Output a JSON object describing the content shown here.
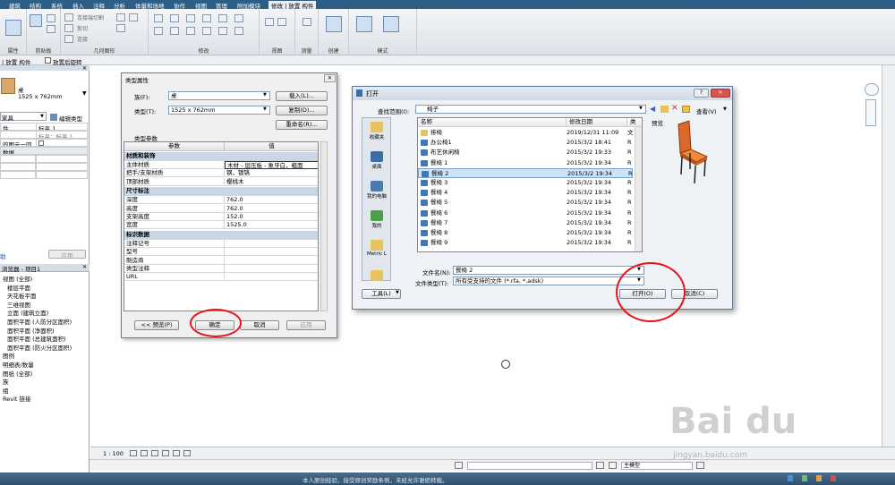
{
  "ribbon": {
    "tabs": [
      "建筑",
      "结构",
      "系统",
      "插入",
      "注释",
      "分析",
      "体量和场地",
      "协作",
      "视图",
      "管理",
      "附加模块",
      "修改 | 放置 构件"
    ],
    "groups": [
      "属性",
      "剪贴板",
      "几何图形",
      "修改",
      "视图",
      "测量",
      "创建",
      "模式"
    ],
    "small_items": [
      "连接端切割",
      "剪切",
      "连接"
    ]
  },
  "option_bar": {
    "left": "| 放置 构件",
    "rotate_label": "放置后旋转"
  },
  "properties_panel": {
    "title": "桌",
    "size": "1525 x 762mm",
    "type_selector": "家具",
    "edit_type": "编辑类型",
    "rows": [
      {
        "label": "件",
        "value": "标高 1"
      },
      {
        "label": "",
        "value": "标高：标高 1"
      },
      {
        "label": "的图元一同...",
        "value": ""
      },
      {
        "label": "数据",
        "value": ""
      }
    ],
    "help": "助",
    "apply": "应用"
  },
  "project_browser": {
    "title": "浏览器 - 项目1",
    "items": [
      "视图 (全部)",
      "楼层平面",
      "天花板平面",
      "三维视图",
      "立面 (建筑立面)",
      "面积平面 (人防分区面积)",
      "面积平面 (净面积)",
      "面积平面 (总建筑面积)",
      "面积平面 (防火分区面积)",
      "图例",
      "明细表/数量",
      "图纸 (全部)",
      "族",
      "组",
      "Revit 链接"
    ]
  },
  "type_props_dialog": {
    "title": "类型属性",
    "family_label": "族(F):",
    "family_value": "桌",
    "type_label": "类型(T):",
    "type_value": "1525 x 762mm",
    "load": "载入(L)...",
    "duplicate": "复制(D)...",
    "rename": "重命名(R)...",
    "section": "类型参数",
    "col_param": "参数",
    "col_value": "值",
    "groups": [
      {
        "name": "材质和装饰",
        "rows": [
          [
            "主体材质",
            "木材 - 层压板 - 象牙白，粗面"
          ],
          [
            "把手/支架材质",
            "钢，镀铬"
          ],
          [
            "顶部材质",
            "樱桃木"
          ]
        ]
      },
      {
        "name": "尺寸标注",
        "rows": [
          [
            "深度",
            "762.0"
          ],
          [
            "高度",
            "762.0"
          ],
          [
            "支架高度",
            "152.0"
          ],
          [
            "宽度",
            "1525.0"
          ]
        ]
      },
      {
        "name": "标识数据",
        "rows": [
          [
            "注释记号",
            ""
          ],
          [
            "型号",
            ""
          ],
          [
            "制造商",
            ""
          ],
          [
            "类型注释",
            ""
          ],
          [
            "URL",
            ""
          ]
        ]
      }
    ],
    "preview": "<< 预览(P)",
    "ok": "确定",
    "cancel": "取消",
    "apply": "应用"
  },
  "open_dialog": {
    "title": "打开",
    "lookin_label": "查找范围(I):",
    "lookin_value": "椅子",
    "view_label": "查看(V)",
    "preview_label": "预览",
    "col_name": "名称",
    "col_date": "修改日期",
    "col_type": "类",
    "files": [
      {
        "name": "排椅",
        "date": "2019/12/31 11:09",
        "type": "文",
        "folder": true
      },
      {
        "name": "办公椅1",
        "date": "2015/3/2 18:41",
        "type": "R"
      },
      {
        "name": "布艺休闲椅",
        "date": "2015/3/2 19:33",
        "type": "R"
      },
      {
        "name": "餐椅 1",
        "date": "2015/3/2 19:34",
        "type": "R"
      },
      {
        "name": "餐椅 2",
        "date": "2015/3/2 19:34",
        "type": "R",
        "selected": true
      },
      {
        "name": "餐椅 3",
        "date": "2015/3/2 19:34",
        "type": "R"
      },
      {
        "name": "餐椅 4",
        "date": "2015/3/2 19:34",
        "type": "R"
      },
      {
        "name": "餐椅 5",
        "date": "2015/3/2 19:34",
        "type": "R"
      },
      {
        "name": "餐椅 6",
        "date": "2015/3/2 19:34",
        "type": "R"
      },
      {
        "name": "餐椅 7",
        "date": "2015/3/2 19:34",
        "type": "R"
      },
      {
        "name": "餐椅 8",
        "date": "2015/3/2 19:34",
        "type": "R"
      },
      {
        "name": "餐椅 9",
        "date": "2015/3/2 19:34",
        "type": "R"
      }
    ],
    "places": [
      "收藏夹",
      "桌面",
      "我的电脑",
      "我的",
      "Metric L"
    ],
    "filename_label": "文件名(N):",
    "filename_value": "餐椅 2",
    "filetype_label": "文件类型(T):",
    "filetype_value": "所有受支持的文件 (*.rfa, *.adsk)",
    "tools": "工具(L)",
    "open": "打开(O)",
    "cancel": "取消(C)"
  },
  "status": {
    "scale": "1 : 100",
    "model": "主模型"
  },
  "taskbar": {
    "notice": "本人原创经验，接受原创奖励条例，未经允许谢绝转载。"
  },
  "watermark": {
    "site": "jingyan.baidu.com"
  },
  "colors": {
    "accent": "#2c5e86",
    "red_annotation": "#e4161b",
    "chair": "#e07a2a",
    "folder": "#e8c25a"
  }
}
